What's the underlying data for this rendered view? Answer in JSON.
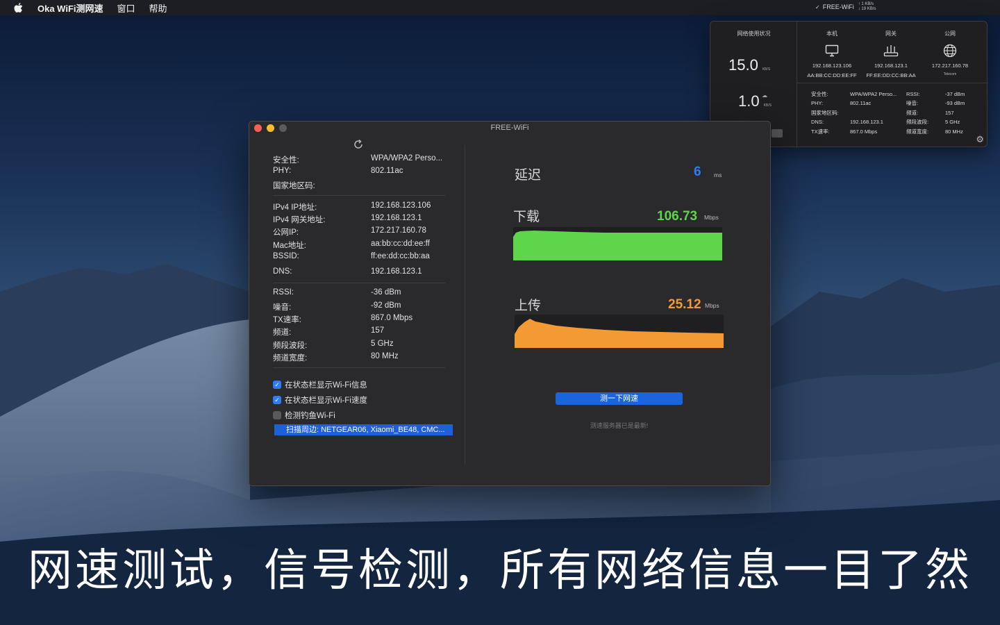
{
  "menubar": {
    "app_name": "Oka WiFi测网速",
    "items": [
      "窗口",
      "帮助"
    ],
    "status_ssid": "FREE-WiFi",
    "status_up": "↑ 1 KB/s",
    "status_down": "↓ 19 KB/s"
  },
  "popover": {
    "usage_title": "网络使用状况",
    "download_speed": "15.0",
    "download_unit": "KB/S",
    "upload_speed": "1.0",
    "upload_unit": "KB/S",
    "columns": [
      {
        "header": "本机",
        "icon": "monitor-icon",
        "line1": "192.168.123.106",
        "line2": "AA:BB:CC:DD:EE:FF"
      },
      {
        "header": "网关",
        "icon": "router-icon",
        "line1": "192.168.123.1",
        "line2": "FF:EE:DD:CC:BB:AA"
      },
      {
        "header": "公网",
        "icon": "globe-icon",
        "line1": "172.217.160.78",
        "line2": "Telecom"
      }
    ],
    "info_left_keys": [
      "安全性:",
      "PHY:",
      "国家地区码:",
      "DNS:",
      "TX速率:"
    ],
    "info_left_values": [
      "WPA/WPA2 Perso...",
      "802.11ac",
      "",
      "192.168.123.1",
      "867.0 Mbps"
    ],
    "info_right_keys": [
      "RSSI:",
      "噪音:",
      "频道:",
      "频段波段:",
      "频道宽度:"
    ],
    "info_right_values": [
      "-37 dBm",
      "-93 dBm",
      "157",
      "5 GHz",
      "80 MHz"
    ]
  },
  "window": {
    "title": "FREE-WiFi",
    "group1": [
      {
        "key": "安全性:",
        "value": "WPA/WPA2 Perso..."
      },
      {
        "key": "PHY:",
        "value": "802.11ac"
      },
      {
        "key": "国家地区码:",
        "value": ""
      }
    ],
    "group2": [
      {
        "key": "IPv4 IP地址:",
        "value": "192.168.123.106"
      },
      {
        "key": "IPv4 网关地址:",
        "value": "192.168.123.1"
      },
      {
        "key": "公网IP:",
        "value": "172.217.160.78"
      },
      {
        "key": "Mac地址:",
        "value": "aa:bb:cc:dd:ee:ff"
      },
      {
        "key": "BSSID:",
        "value": "ff:ee:dd:cc:bb:aa"
      },
      {
        "key": "DNS:",
        "value": "192.168.123.1"
      }
    ],
    "group3": [
      {
        "key": "RSSI:",
        "value": "-36 dBm"
      },
      {
        "key": "噪音:",
        "value": "-92 dBm"
      },
      {
        "key": "TX速率:",
        "value": "867.0 Mbps"
      },
      {
        "key": "频道:",
        "value": "157"
      },
      {
        "key": "频段波段:",
        "value": "5 GHz"
      },
      {
        "key": "频道宽度:",
        "value": "80 MHz"
      }
    ],
    "options": [
      {
        "label": "在状态栏显示Wi-Fi信息",
        "checked": true
      },
      {
        "label": "在状态栏显示Wi-Fi速度",
        "checked": true
      },
      {
        "label": "检测钓鱼Wi-Fi",
        "checked": false
      }
    ],
    "scan_text": "扫描周边: NETGEAR06, Xiaomi_BE48, CMC...",
    "latency_label": "延迟",
    "latency_value": "6",
    "latency_unit": "ms",
    "download_label": "下载",
    "download_value": "106.73",
    "download_unit": "Mbps",
    "upload_label": "上传",
    "upload_value": "25.12",
    "upload_unit": "Mbps",
    "test_button": "测一下网速",
    "server_note": "测速服务器已是最新!",
    "colors": {
      "download": "#5fd54c",
      "upload": "#f49a34",
      "accent": "#2e7cf6",
      "latency": "#2e7cf6"
    }
  },
  "caption": "网速测试，信号检测，所有网络信息一目了然"
}
